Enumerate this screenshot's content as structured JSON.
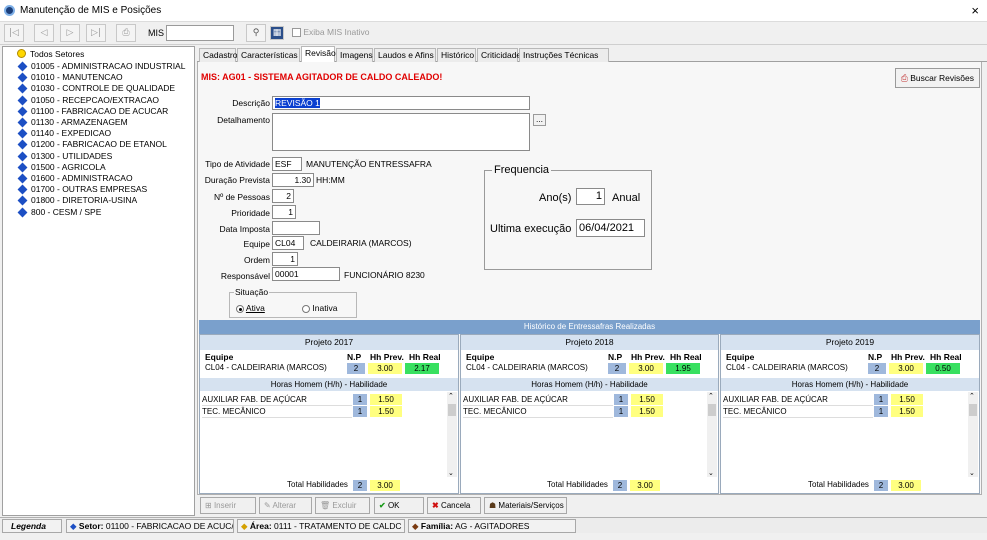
{
  "window": {
    "title": "Manutenção de MIS e Posições",
    "close": "×"
  },
  "toolbar": {
    "mis_label": "MIS",
    "mis_value": "",
    "exibe_inativo": "Exiba MIS Inativo"
  },
  "tree": {
    "root": "Todos Setores",
    "items": [
      "01005 - ADMINISTRACAO INDUSTRIAL",
      "01010 - MANUTENCAO",
      "01030 - CONTROLE DE QUALIDADE",
      "01050 - RECEPCAO/EXTRACAO",
      "01100 - FABRICACAO DE ACUCAR",
      "01130 - ARMAZENAGEM",
      "01140 - EXPEDICAO",
      "01200 - FABRICACAO DE ETANOL",
      "01300 - UTILIDADES",
      "01500 - AGRICOLA",
      "01600 - ADMINISTRACAO",
      "01700 - OUTRAS EMPRESAS",
      "01800 - DIRETORIA-USINA",
      "800 - CESM / SPE"
    ]
  },
  "tabs": [
    "Cadastro",
    "Características",
    "Revisão",
    "Imagens",
    "Laudos e Afins",
    "Histórico",
    "Criticidade",
    "Instruções Técnicas"
  ],
  "mis_title": "MIS: AG01 - SISTEMA AGITADOR DE CALDO CALEADO!",
  "buscar_revisoes": "Buscar Revisões",
  "form": {
    "descricao_label": "Descrição",
    "descricao": "REVISÃO 1",
    "detalhamento_label": "Detalhamento",
    "ellipsis": "...",
    "tipo_label": "Tipo de Atividade",
    "tipo": "ESF",
    "tipo_desc": "MANUTENÇÃO ENTRESSAFRA",
    "duracao_label": "Duração Prevista",
    "duracao": "1.30",
    "duracao_unit": "HH:MM",
    "pessoas_label": "Nº de Pessoas",
    "pessoas": "2",
    "prioridade_label": "Prioridade",
    "prioridade": "1",
    "data_label": "Data Imposta",
    "data": "",
    "equipe_label": "Equipe",
    "equipe": "CL04",
    "equipe_desc": "CALDEIRARIA (MARCOS)",
    "ordem_label": "Ordem",
    "ordem": "1",
    "responsavel_label": "Responsável",
    "responsavel": "00001",
    "responsavel_desc": "FUNCIONÁRIO 8230",
    "situacao_label": "Situação",
    "ativa": "Ativa",
    "inativa": "Inativa"
  },
  "frequencia": {
    "title": "Frequencia",
    "anos_label": "Ano(s)",
    "anos": "1",
    "anual": "Anual",
    "ultima_label": "Ultima execução",
    "ultima": "06/04/2021"
  },
  "historico": {
    "title": "Histórico de Entressafras Realizadas",
    "projetos": [
      {
        "name": "Projeto 2017",
        "np": "2",
        "hh_prev": "3.00",
        "hh_real": "2.17",
        "real_color": "#38e060"
      },
      {
        "name": "Projeto 2018",
        "np": "2",
        "hh_prev": "3.00",
        "hh_real": "1.95",
        "real_color": "#38e060"
      },
      {
        "name": "Projeto 2019",
        "np": "2",
        "hh_prev": "3.00",
        "hh_real": "0.50",
        "real_color": "#38e060"
      }
    ],
    "equipe_hdr": "Equipe",
    "np_hdr": "N.P",
    "prev_hdr": "Hh Prev.",
    "real_hdr": "Hh Real",
    "equipe_val": "CL04 - CALDEIRARIA (MARCOS)",
    "horas_hdr": "Horas Homem (H/h) - Habilidade",
    "skills": [
      {
        "name": "AUXILIAR FAB. DE AÇÚCAR",
        "np": "1",
        "hh": "1.50"
      },
      {
        "name": "TEC. MECÂNICO",
        "np": "1",
        "hh": "1.50"
      }
    ],
    "total_label": "Total Habilidades",
    "total_np": "2",
    "total_hh": "3.00"
  },
  "footer": {
    "inserir": "Inserir",
    "alterar": "Alterar",
    "excluir": "Excluir",
    "ok": "OK",
    "cancela": "Cancela",
    "materiais": "Materiais/Serviços"
  },
  "status": {
    "legenda": "Legenda",
    "setor_label": "Setor:",
    "setor": "01100 - FABRICACAO DE ACUC/",
    "area_label": "Área:",
    "area": "0111 - TRATAMENTO DE CALDC",
    "familia_label": "Família:",
    "familia": "AG - AGITADORES"
  }
}
